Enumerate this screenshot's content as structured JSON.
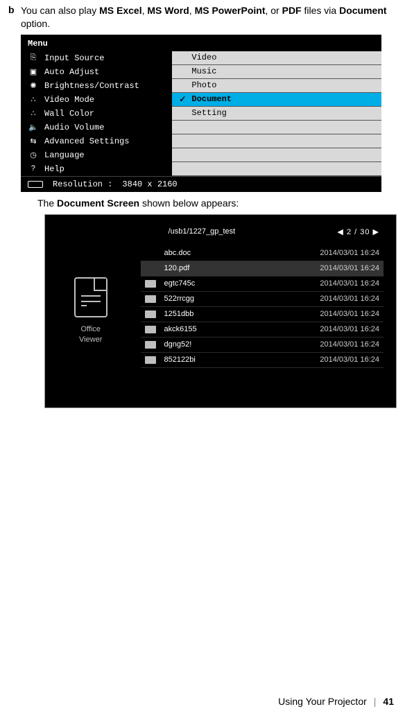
{
  "intro": {
    "bullet": "b",
    "text_pre": "You can also play ",
    "apps": [
      "MS Excel",
      "MS Word",
      "MS PowerPoint",
      "PDF"
    ],
    "text_mid1": ", ",
    "text_mid2": ", ",
    "text_mid3": ", or ",
    "text_post": " files via ",
    "option": "Document",
    "text_end": " option."
  },
  "osd": {
    "title": "Menu",
    "left_items": [
      {
        "icon": "⎘",
        "label": "Input Source"
      },
      {
        "icon": "▣",
        "label": "Auto Adjust"
      },
      {
        "icon": "✺",
        "label": "Brightness/Contrast"
      },
      {
        "icon": "∴",
        "label": "Video Mode"
      },
      {
        "icon": "∴",
        "label": "Wall Color"
      },
      {
        "icon": "🔈",
        "label": "Audio Volume"
      },
      {
        "icon": "⇆",
        "label": "Advanced Settings"
      },
      {
        "icon": "◷",
        "label": "Language"
      },
      {
        "icon": "?",
        "label": "Help"
      }
    ],
    "right_items": [
      {
        "label": "Video",
        "selected": false
      },
      {
        "label": "Music",
        "selected": false
      },
      {
        "label": "Photo",
        "selected": false
      },
      {
        "label": "Document",
        "selected": true
      },
      {
        "label": "Setting",
        "selected": false
      },
      {
        "label": "",
        "selected": false
      },
      {
        "label": "",
        "selected": false
      },
      {
        "label": "",
        "selected": false
      },
      {
        "label": "",
        "selected": false
      }
    ],
    "resolution_label": "Resolution :",
    "resolution_value": "3840 x 2160"
  },
  "mid": {
    "pre": "The ",
    "bold": "Document Screen",
    "post": " shown below appears:"
  },
  "docscreen": {
    "left_label_1": "Office",
    "left_label_2": "Viewer",
    "path": "/usb1/1227_gp_test",
    "page_indicator": "◀  2 / 30  ▶",
    "rows": [
      {
        "type": "file-noicon",
        "name": "abc.doc",
        "date": "2014/03/01  16:24",
        "selected": false
      },
      {
        "type": "file-noicon",
        "name": "120.pdf",
        "date": "2014/03/01  16:24",
        "selected": true
      },
      {
        "type": "folder",
        "name": "egtc745c",
        "date": "2014/03/01  16:24",
        "selected": false
      },
      {
        "type": "folder",
        "name": "522rrcgg",
        "date": "2014/03/01  16:24",
        "selected": false
      },
      {
        "type": "folder",
        "name": "1251dbb",
        "date": "2014/03/01  16:24",
        "selected": false
      },
      {
        "type": "folder",
        "name": "akck6155",
        "date": "2014/03/01  16:24",
        "selected": false
      },
      {
        "type": "folder",
        "name": "dgng52!",
        "date": "2014/03/01  16:24",
        "selected": false
      },
      {
        "type": "folder",
        "name": "852122bi",
        "date": "2014/03/01  16:24",
        "selected": false
      }
    ]
  },
  "footer": {
    "section": "Using Your Projector",
    "page": "41"
  }
}
